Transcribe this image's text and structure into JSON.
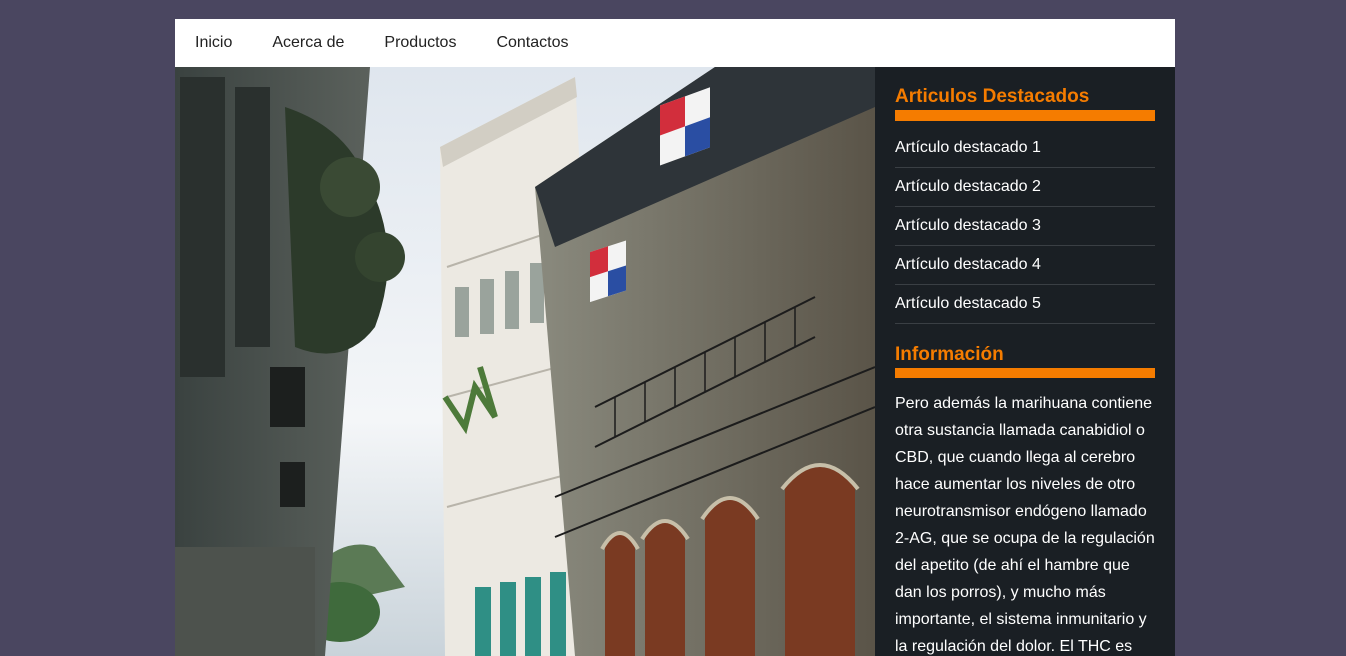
{
  "nav": {
    "items": [
      "Inicio",
      "Acerca de",
      "Productos",
      "Contactos"
    ]
  },
  "hero": {
    "image_description": "street-balconies-photo"
  },
  "sidebar": {
    "featured_title": "Articulos Destacados",
    "featured_items": [
      "Artículo destacado 1",
      "Artículo destacado 2",
      "Artículo destacado 3",
      "Artículo destacado 4",
      "Artículo destacado 5"
    ],
    "info_title": "Información",
    "info_text": "Pero además la marihuana contiene otra sustancia llamada canabidiol o CBD, que cuando llega al cerebro hace aumentar los niveles de otro neurotransmisor endógeno llamado 2-AG, que se ocupa de la regulación del apetito (de ahí el hambre que dan los porros), y mucho más importante, el sistema inmunitario y la regulación del dolor. El THC es"
  },
  "colors": {
    "page_background": "#4a4660",
    "accent": "#f57c00",
    "sidebar_background": "#1a1f24",
    "nav_background": "#ffffff"
  }
}
